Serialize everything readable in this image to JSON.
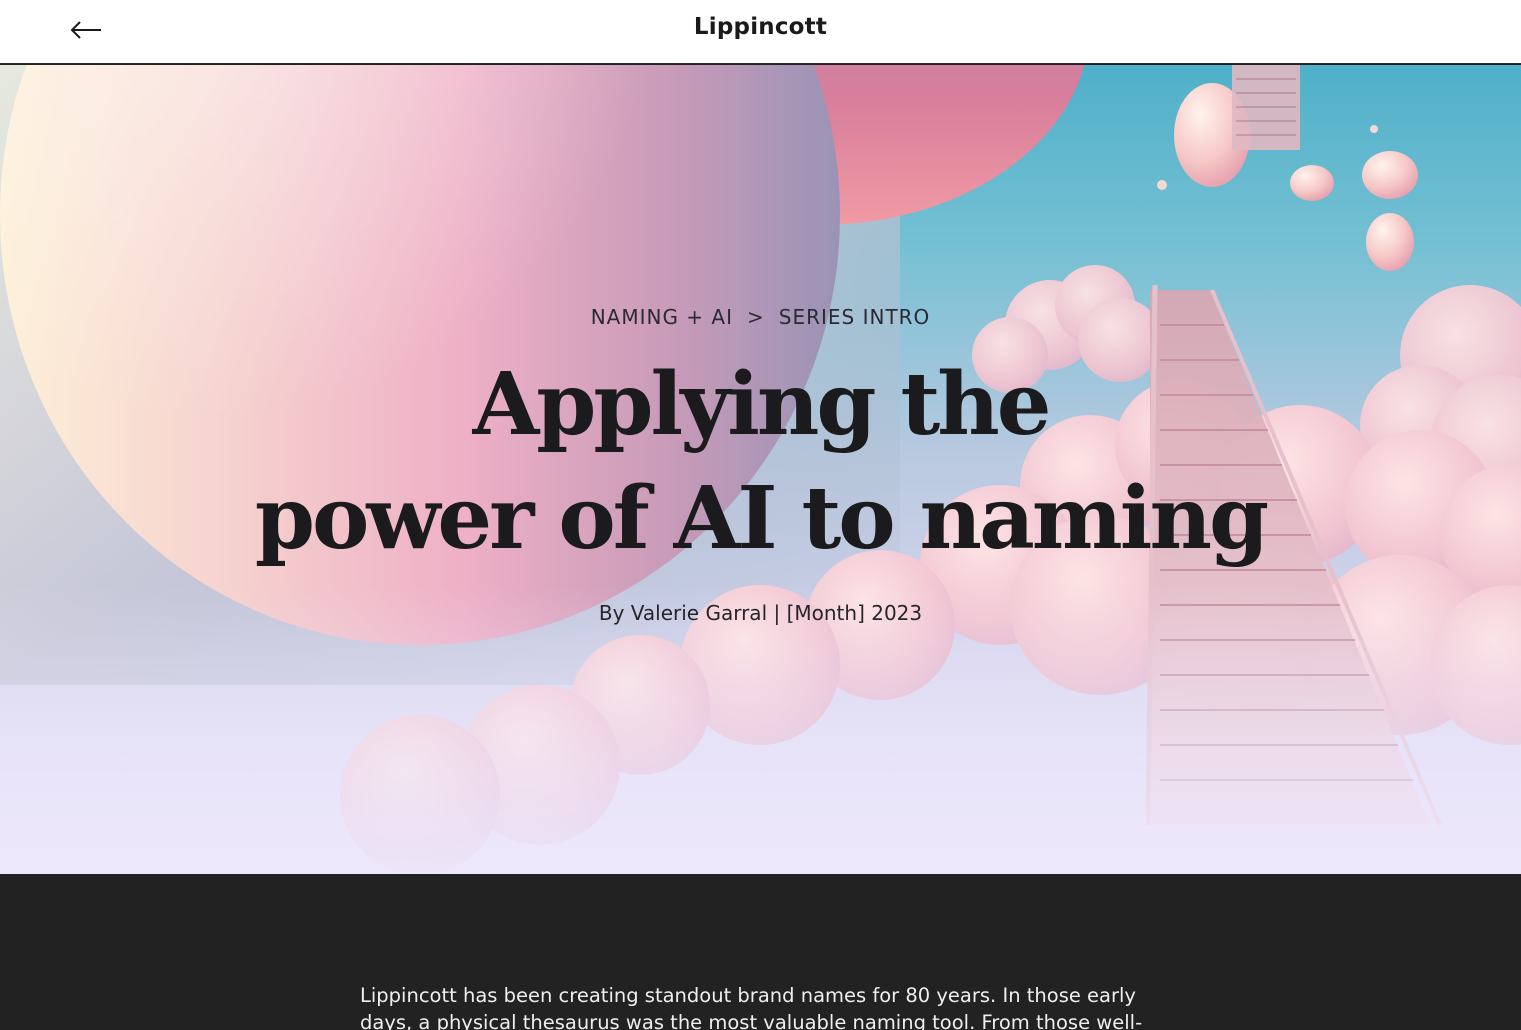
{
  "header": {
    "back_icon": "arrow-left-icon",
    "brand": "Lippincott"
  },
  "hero": {
    "breadcrumb": {
      "section": "NAMING + AI",
      "separator": ">",
      "page": "SERIES INTRO"
    },
    "title_line1": "Applying the",
    "title_line2": "power of AI to naming",
    "byline": "By Valerie Garral | [Month] 2023"
  },
  "article": {
    "intro_line1": "Lippincott has been creating standout brand names for 80 years. In those early",
    "intro_line2": "days, a physical thesaurus was the most valuable naming tool. From those well-"
  },
  "colors": {
    "header_bg": "#ffffff",
    "dark_bg": "#222222",
    "sky_top": "#4fb0c9",
    "cloud_pink": "#f3c9d3"
  }
}
